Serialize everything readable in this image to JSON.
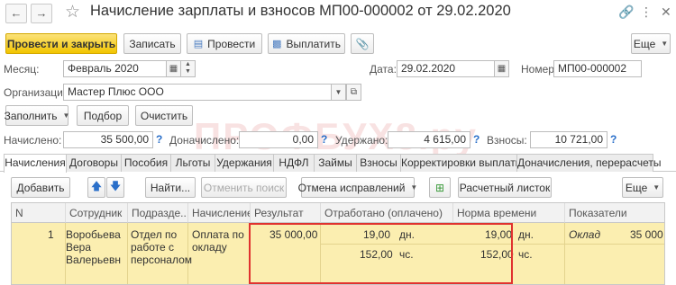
{
  "window": {
    "title": "Начисление зарплаты и взносов МП00-000002 от 29.02.2020"
  },
  "toolbar": {
    "post_close": "Провести и закрыть",
    "save": "Записать",
    "post": "Провести",
    "pay": "Выплатить",
    "more": "Еще"
  },
  "form": {
    "month_label": "Месяц:",
    "month_value": "Февраль 2020",
    "date_label": "Дата:",
    "date_value": "29.02.2020",
    "number_label": "Номер:",
    "number_value": "МП00-000002",
    "org_label": "Организация:",
    "org_value": "Мастер Плюс ООО"
  },
  "actions": {
    "fill": "Заполнить",
    "select": "Подбор",
    "clear": "Очистить"
  },
  "totals": {
    "accrued_label": "Начислено:",
    "accrued_value": "35 500,00",
    "additional_label": "Доначислено:",
    "additional_value": "0,00",
    "withheld_label": "Удержано:",
    "withheld_value": "4 615,00",
    "contributions_label": "Взносы:",
    "contributions_value": "10 721,00",
    "help": "?"
  },
  "tabs": [
    "Начисления",
    "Договоры",
    "Пособия",
    "Льготы",
    "Удержания",
    "НДФЛ",
    "Займы",
    "Взносы",
    "Корректировки выплаты",
    "Доначисления, перерасчеты"
  ],
  "table_toolbar": {
    "add": "Добавить",
    "find": "Найти...",
    "cancel_search": "Отменить поиск",
    "cancel_corrections": "Отмена исправлений",
    "payslip": "Расчетный листок",
    "more": "Еще"
  },
  "table": {
    "columns": [
      "N",
      "Сотрудник",
      "Подразде...",
      "Начисление",
      "Результат",
      "Отработано (оплачено)",
      "Норма времени",
      "Показатели"
    ],
    "row": {
      "n": "1",
      "employee": [
        "Воробьева",
        "Вера",
        "Валерьевн"
      ],
      "department": [
        "Отдел по",
        "работе с",
        "персоналом"
      ],
      "accrual": [
        "Оплата по",
        "окладу"
      ],
      "result": "35 000,00",
      "worked_days": "19,00",
      "worked_days_unit": "дн.",
      "worked_hours": "152,00",
      "worked_hours_unit": "чс.",
      "norm_days": "19,00",
      "norm_days_unit": "дн.",
      "norm_hours": "152,00",
      "norm_hours_unit": "чс.",
      "indicator_name": "Оклад",
      "indicator_value": "35 000"
    }
  },
  "watermark": "ПРОФБУХ8.ру"
}
